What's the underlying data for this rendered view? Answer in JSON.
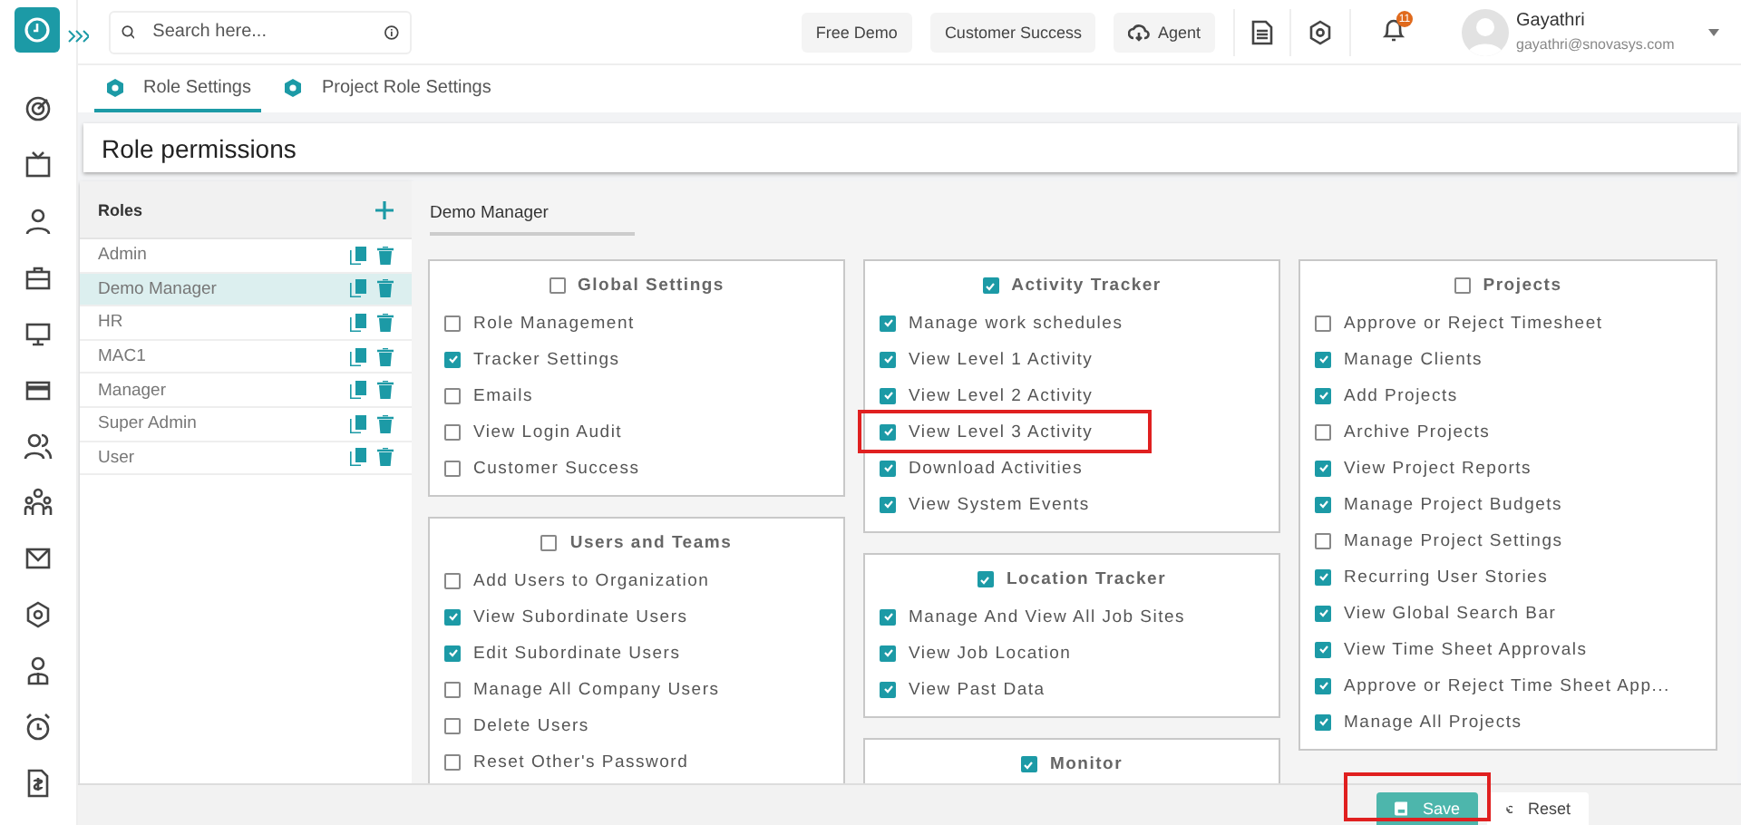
{
  "search": {
    "placeholder": "Search here..."
  },
  "header_buttons": [
    {
      "label": "Free Demo",
      "kind": "plain"
    },
    {
      "label": "Customer Success",
      "kind": "plain"
    },
    {
      "label": "Agent",
      "kind": "cloud"
    }
  ],
  "notifications": {
    "count": "11"
  },
  "user": {
    "name": "Gayathri",
    "email": "gayathri@snovasys.com"
  },
  "tabs": [
    {
      "label": "Role Settings",
      "selected": true
    },
    {
      "label": "Project Role Settings",
      "selected": false
    }
  ],
  "page_title": "Role permissions",
  "roles": {
    "title": "Roles",
    "items": [
      {
        "name": "Admin",
        "selected": false
      },
      {
        "name": "Demo Manager",
        "selected": true
      },
      {
        "name": "HR",
        "selected": false
      },
      {
        "name": "MAC1",
        "selected": false
      },
      {
        "name": "Manager",
        "selected": false
      },
      {
        "name": "Super Admin",
        "selected": false
      },
      {
        "name": "User",
        "selected": false
      }
    ]
  },
  "role_name": "Demo Manager",
  "permission_columns": [
    {
      "groups": [
        {
          "title": "Global Settings",
          "checked": false,
          "items": [
            {
              "label": "Role Management",
              "checked": false,
              "highlighted": false
            },
            {
              "label": "Tracker Settings",
              "checked": true,
              "highlighted": false
            },
            {
              "label": "Emails",
              "checked": false,
              "highlighted": false
            },
            {
              "label": "View Login Audit",
              "checked": false,
              "highlighted": false
            },
            {
              "label": "Customer Success",
              "checked": false,
              "highlighted": false
            }
          ]
        },
        {
          "title": "Users and Teams",
          "checked": false,
          "items": [
            {
              "label": "Add Users to Organization",
              "checked": false,
              "highlighted": false
            },
            {
              "label": "View Subordinate Users",
              "checked": true,
              "highlighted": false
            },
            {
              "label": "Edit Subordinate Users",
              "checked": true,
              "highlighted": false
            },
            {
              "label": "Manage All Company Users",
              "checked": false,
              "highlighted": false
            },
            {
              "label": "Delete Users",
              "checked": false,
              "highlighted": false
            },
            {
              "label": "Reset Other's Password",
              "checked": false,
              "highlighted": false
            }
          ]
        }
      ]
    },
    {
      "groups": [
        {
          "title": "Activity Tracker",
          "checked": true,
          "items": [
            {
              "label": "Manage work schedules",
              "checked": true,
              "highlighted": false
            },
            {
              "label": "View Level 1 Activity",
              "checked": true,
              "highlighted": false
            },
            {
              "label": "View Level 2 Activity",
              "checked": true,
              "highlighted": false
            },
            {
              "label": "View Level 3 Activity",
              "checked": true,
              "highlighted": true
            },
            {
              "label": "Download Activities",
              "checked": true,
              "highlighted": false
            },
            {
              "label": "View System Events",
              "checked": true,
              "highlighted": false
            }
          ]
        },
        {
          "title": "Location Tracker",
          "checked": true,
          "items": [
            {
              "label": "Manage And View All Job Sites",
              "checked": true,
              "highlighted": false
            },
            {
              "label": "View Job Location",
              "checked": true,
              "highlighted": false
            },
            {
              "label": "View Past Data",
              "checked": true,
              "highlighted": false
            }
          ]
        },
        {
          "title": "Monitor",
          "checked": true
        }
      ]
    },
    {
      "groups": [
        {
          "title": "Projects",
          "checked": false,
          "items": [
            {
              "label": "Approve or Reject Timesheet",
              "checked": false,
              "highlighted": false
            },
            {
              "label": "Manage Clients",
              "checked": true,
              "highlighted": false
            },
            {
              "label": "Add Projects",
              "checked": true,
              "highlighted": false
            },
            {
              "label": "Archive Projects",
              "checked": false,
              "highlighted": false
            },
            {
              "label": "View Project Reports",
              "checked": true,
              "highlighted": false
            },
            {
              "label": "Manage Project Budgets",
              "checked": true,
              "highlighted": false
            },
            {
              "label": "Manage Project Settings",
              "checked": false,
              "highlighted": false
            },
            {
              "label": "Recurring User Stories",
              "checked": true,
              "highlighted": false
            },
            {
              "label": "View Global Search Bar",
              "checked": true,
              "highlighted": false
            },
            {
              "label": "View Time Sheet Approvals",
              "checked": true,
              "highlighted": false
            },
            {
              "label": "Approve or Reject Time Sheet App...",
              "checked": true,
              "highlighted": false
            },
            {
              "label": "Manage All Projects",
              "checked": true,
              "highlighted": false
            }
          ]
        }
      ]
    }
  ],
  "footer": {
    "save": {
      "label": "Save",
      "highlighted": true
    },
    "reset": {
      "label": "Reset"
    }
  }
}
